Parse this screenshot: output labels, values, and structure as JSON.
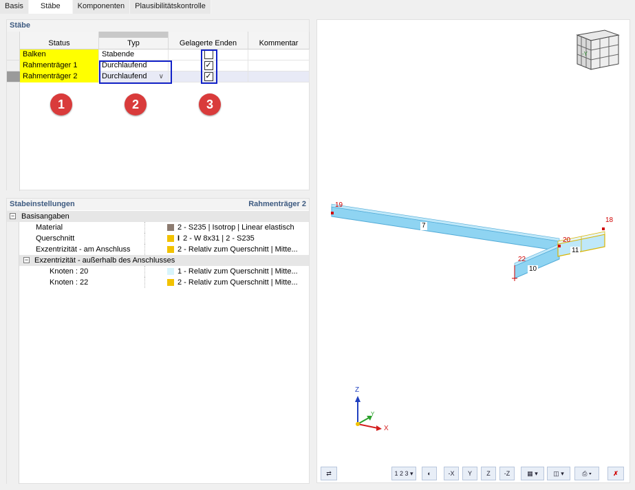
{
  "tabs": [
    "Basis",
    "Stäbe",
    "Komponenten",
    "Plausibilitätskontrolle"
  ],
  "active_tab": "Stäbe",
  "staebe": {
    "title": "Stäbe",
    "columns": [
      "Status",
      "Typ",
      "Gelagerte Enden",
      "Kommentar"
    ],
    "rows": [
      {
        "status": "Balken",
        "typ": "Stabende",
        "gelagert": false,
        "kommentar": ""
      },
      {
        "status": "Rahmenträger 1",
        "typ": "Durchlaufend",
        "gelagert": true,
        "kommentar": ""
      },
      {
        "status": "Rahmenträger 2",
        "typ": "Durchlaufend",
        "gelagert": true,
        "kommentar": ""
      }
    ],
    "badges": [
      "1",
      "2",
      "3"
    ],
    "check_mark": "✓"
  },
  "settings": {
    "title": "Stabeinstellungen",
    "context": "Rahmenträger 2",
    "group1": "Basisangaben",
    "material_label": "Material",
    "material_value": "2 - S235 | Isotrop | Linear elastisch",
    "querschnitt_label": "Querschnitt",
    "querschnitt_value": "2 - W 8x31 | 2 - S235",
    "exz_anschluss_label": "Exzentrizität - am Anschluss",
    "exz_anschluss_value": "2 - Relativ zum Querschnitt | Mitte...",
    "group2": "Exzentrizität - außerhalb des Anschlusses",
    "knoten20_label": "Knoten : 20",
    "knoten20_value": "1 - Relativ zum Querschnitt | Mitte...",
    "knoten22_label": "Knoten : 22",
    "knoten22_value": "2 - Relativ zum Querschnitt | Mitte...",
    "colors": {
      "material": "#8c7b70",
      "querschnitt": "#f2c200",
      "exz": "#f2c200",
      "knoten20": "#d8f4fb",
      "knoten22": "#f2c200"
    }
  },
  "view": {
    "nodes": [
      "19",
      "20",
      "18",
      "22"
    ],
    "members": [
      "7",
      "11",
      "10"
    ],
    "axes": {
      "x": "X",
      "y": "Y",
      "z": "Z"
    },
    "toolbar": [
      "1 2 3",
      "-X",
      "Y",
      "Z",
      "-Z"
    ]
  }
}
